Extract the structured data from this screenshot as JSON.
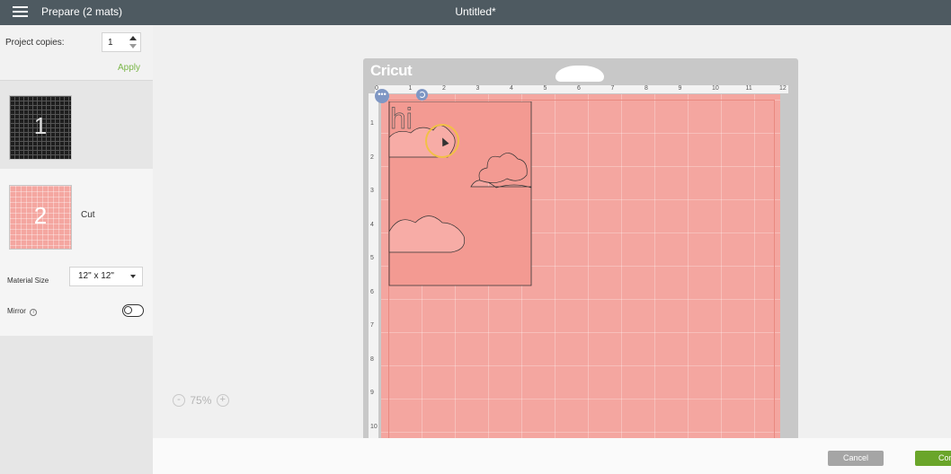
{
  "topbar": {
    "title": "Prepare (2 mats)",
    "document": "Untitled*"
  },
  "left_panel": {
    "copies_label": "Project copies:",
    "copies_value": "1",
    "apply_label": "Apply",
    "mats": [
      {
        "number": "1",
        "label": ""
      },
      {
        "number": "2",
        "label": "Cut"
      }
    ],
    "material_size_label": "Material Size",
    "material_size_value": "12\" x 12\"",
    "mirror_label": "Mirror",
    "mirror_on": false
  },
  "mat": {
    "brand": "Cricut",
    "ruler_top": [
      "0",
      "1",
      "2",
      "3",
      "4",
      "5",
      "6",
      "7",
      "8",
      "9",
      "10",
      "11",
      "12"
    ],
    "ruler_left": [
      "1",
      "2",
      "3",
      "4",
      "5",
      "6",
      "7",
      "8",
      "9",
      "10"
    ],
    "design_text": "hi",
    "colors": {
      "mat": "#f4a6a0",
      "frame": "#c8c8c8",
      "cursor_ring": "#f2c046"
    }
  },
  "zoom": {
    "minus": "-",
    "value": "75%",
    "plus": "+"
  },
  "bottom": {
    "cancel_label": "Cancel",
    "continue_label": "Continue"
  }
}
